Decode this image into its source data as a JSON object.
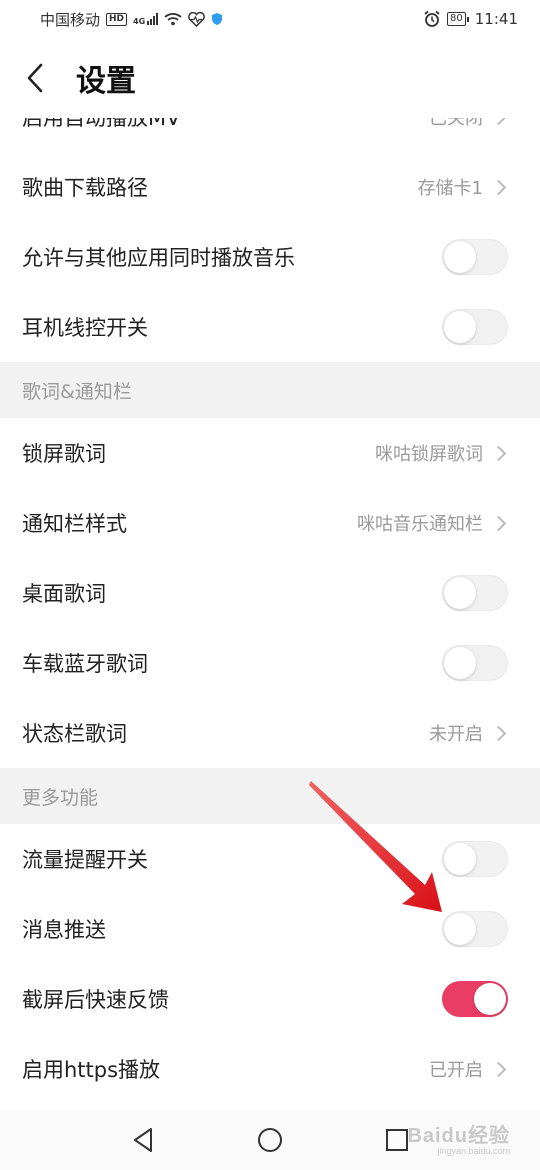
{
  "status_bar": {
    "carrier": "中国移动",
    "hd_badge": "HD",
    "network": "4G",
    "battery": "80",
    "time": "11:41"
  },
  "header": {
    "title": "设置"
  },
  "rows": {
    "autoplay_mv": {
      "label": "启用自动播放MV",
      "value": "已关闭"
    },
    "download_path": {
      "label": "歌曲下载路径",
      "value": "存储卡1"
    },
    "allow_other_apps": {
      "label": "允许与其他应用同时播放音乐",
      "toggle": false
    },
    "earphone_control": {
      "label": "耳机线控开关",
      "toggle": false
    },
    "lock_screen_lyrics": {
      "label": "锁屏歌词",
      "value": "咪咕锁屏歌词"
    },
    "notification_style": {
      "label": "通知栏样式",
      "value": "咪咕音乐通知栏"
    },
    "desktop_lyrics": {
      "label": "桌面歌词",
      "toggle": false
    },
    "car_bluetooth_lyrics": {
      "label": "车载蓝牙歌词",
      "toggle": false
    },
    "statusbar_lyrics": {
      "label": "状态栏歌词",
      "value": "未开启"
    },
    "data_reminder": {
      "label": "流量提醒开关",
      "toggle": false
    },
    "push_messages": {
      "label": "消息推送",
      "toggle": false
    },
    "screenshot_feedback": {
      "label": "截屏后快速反馈",
      "toggle": true
    },
    "https_playback": {
      "label": "启用https播放",
      "value": "已开启"
    }
  },
  "sections": {
    "lyrics_notification": "歌词&通知栏",
    "more_features": "更多功能"
  },
  "colors": {
    "accent": "#ea3d63",
    "annotation_arrow": "#e0161b",
    "section_bg": "#f2f2f2"
  },
  "watermark": {
    "brand": "Baidu经验",
    "url": "jingyan.baidu.com"
  }
}
